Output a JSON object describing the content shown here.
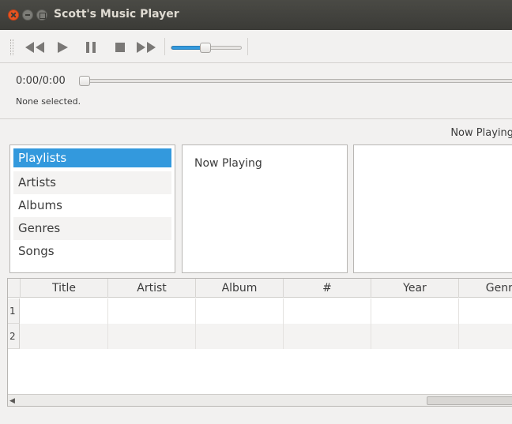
{
  "window": {
    "title": "Scott's Music Player"
  },
  "toolbar": {
    "volume_level": 0.48
  },
  "player": {
    "time": "0:00/0:00",
    "status": "None selected.",
    "position": 0.0
  },
  "header": {
    "now_playing": "Now Playing"
  },
  "browse": {
    "items": [
      {
        "label": "Playlists"
      },
      {
        "label": "Artists"
      },
      {
        "label": "Albums"
      },
      {
        "label": "Genres"
      },
      {
        "label": "Songs"
      }
    ],
    "selected": "Playlists"
  },
  "playlists": {
    "items": [
      {
        "label": "Now Playing"
      }
    ]
  },
  "table": {
    "columns": [
      "Title",
      "Artist",
      "Album",
      "#",
      "Year",
      "Genre"
    ],
    "rows": [
      "1",
      "2"
    ]
  },
  "icons": {
    "previous": "previous-icon",
    "play": "play-icon",
    "pause": "pause-icon",
    "stop": "stop-icon",
    "next": "next-icon"
  },
  "colors": {
    "accent": "#3399dd",
    "titlebar": "#3b3b37",
    "close": "#e95420"
  }
}
